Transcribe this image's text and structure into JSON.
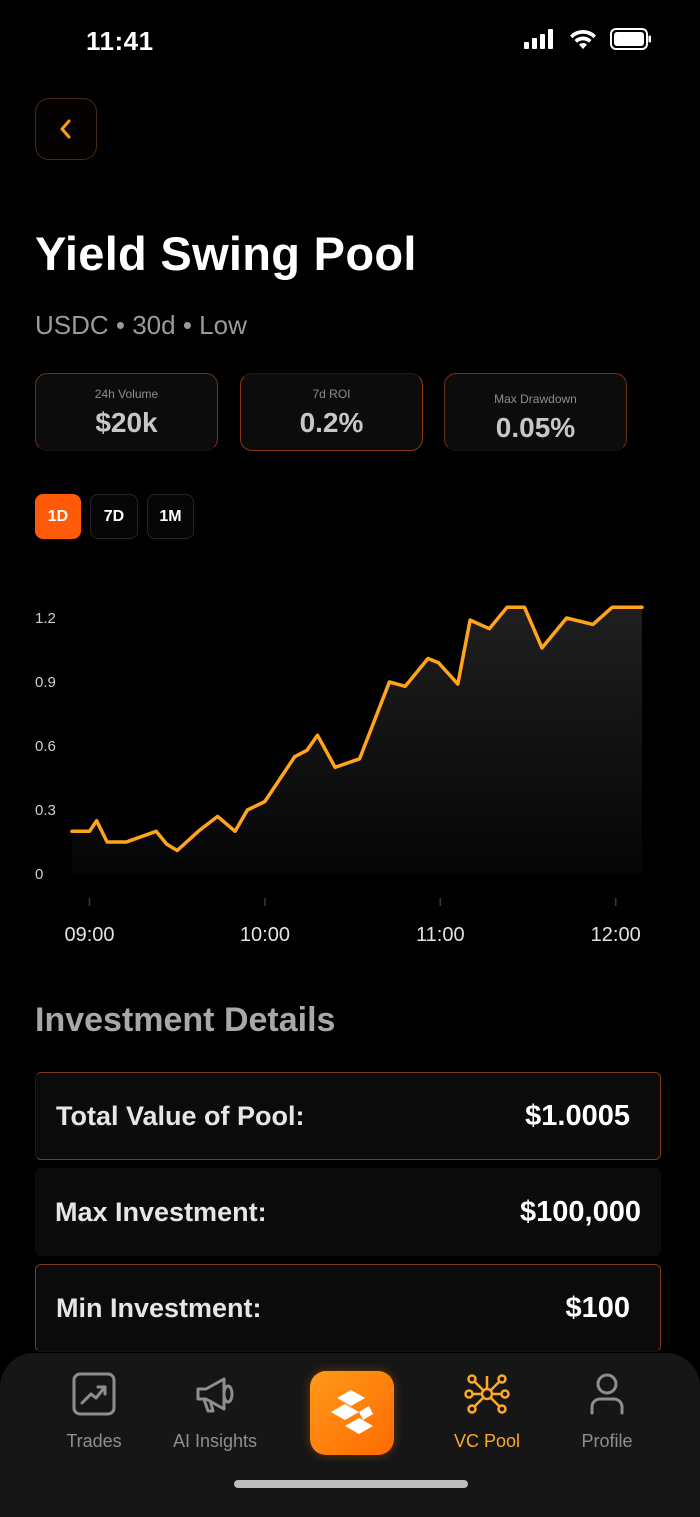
{
  "status_bar": {
    "time": "11:41"
  },
  "pool": {
    "title": "Yield Swing Pool",
    "subtitle": "USDC • 30d • Low"
  },
  "stats": [
    {
      "label": "24h Volume",
      "value": "$20k"
    },
    {
      "label": "7d ROI",
      "value": "0.2%"
    },
    {
      "label": "Max Drawdown",
      "value": "0.05%"
    }
  ],
  "ranges": {
    "selected": "1D",
    "options": [
      "1D",
      "7D",
      "1M"
    ]
  },
  "colors": {
    "accent": "#ff5a0a",
    "line": "#ffa41c",
    "active_nav": "#ffa928"
  },
  "chart_data": {
    "type": "area",
    "x_tick_labels": [
      "09:00",
      "10:00",
      "11:00",
      "12:00"
    ],
    "y_tick_labels": [
      "0",
      "0.3",
      "0.6",
      "0.9",
      "1.2"
    ],
    "ylim": [
      0,
      1.2
    ],
    "xlim_hours": [
      8.9,
      12.15
    ],
    "series": [
      {
        "x": [
          8.9,
          9.0,
          9.04,
          9.1,
          9.21,
          9.38,
          9.44,
          9.5,
          9.62,
          9.73,
          9.83,
          9.9,
          10.0,
          10.17,
          10.24,
          10.3,
          10.4,
          10.54,
          10.71,
          10.8,
          10.93,
          10.99,
          11.1,
          11.17,
          11.28,
          11.38,
          11.48,
          11.58,
          11.72,
          11.87,
          11.98,
          12.05,
          12.15
        ],
        "y": [
          0.2,
          0.2,
          0.25,
          0.15,
          0.15,
          0.2,
          0.14,
          0.11,
          0.2,
          0.27,
          0.2,
          0.3,
          0.34,
          0.55,
          0.58,
          0.65,
          0.5,
          0.54,
          0.9,
          0.88,
          1.01,
          0.99,
          0.89,
          1.19,
          1.15,
          1.25,
          1.25,
          1.06,
          1.2,
          1.17,
          1.25,
          1.25,
          1.25
        ]
      }
    ]
  },
  "investment_details": {
    "title": "Investment Details",
    "rows": [
      {
        "label": "Total Value of Pool:",
        "value": "$1.0005"
      },
      {
        "label": "Max Investment:",
        "value": "$100,000"
      },
      {
        "label": "Min Investment:",
        "value": "$100"
      }
    ]
  },
  "nav": {
    "items": [
      {
        "label": "Trades",
        "icon": "trades-icon"
      },
      {
        "label": "AI Insights",
        "icon": "megaphone-icon"
      },
      {
        "label": "VC Pool",
        "icon": "network-icon"
      },
      {
        "label": "Profile",
        "icon": "profile-icon"
      }
    ],
    "active": "VC Pool"
  }
}
